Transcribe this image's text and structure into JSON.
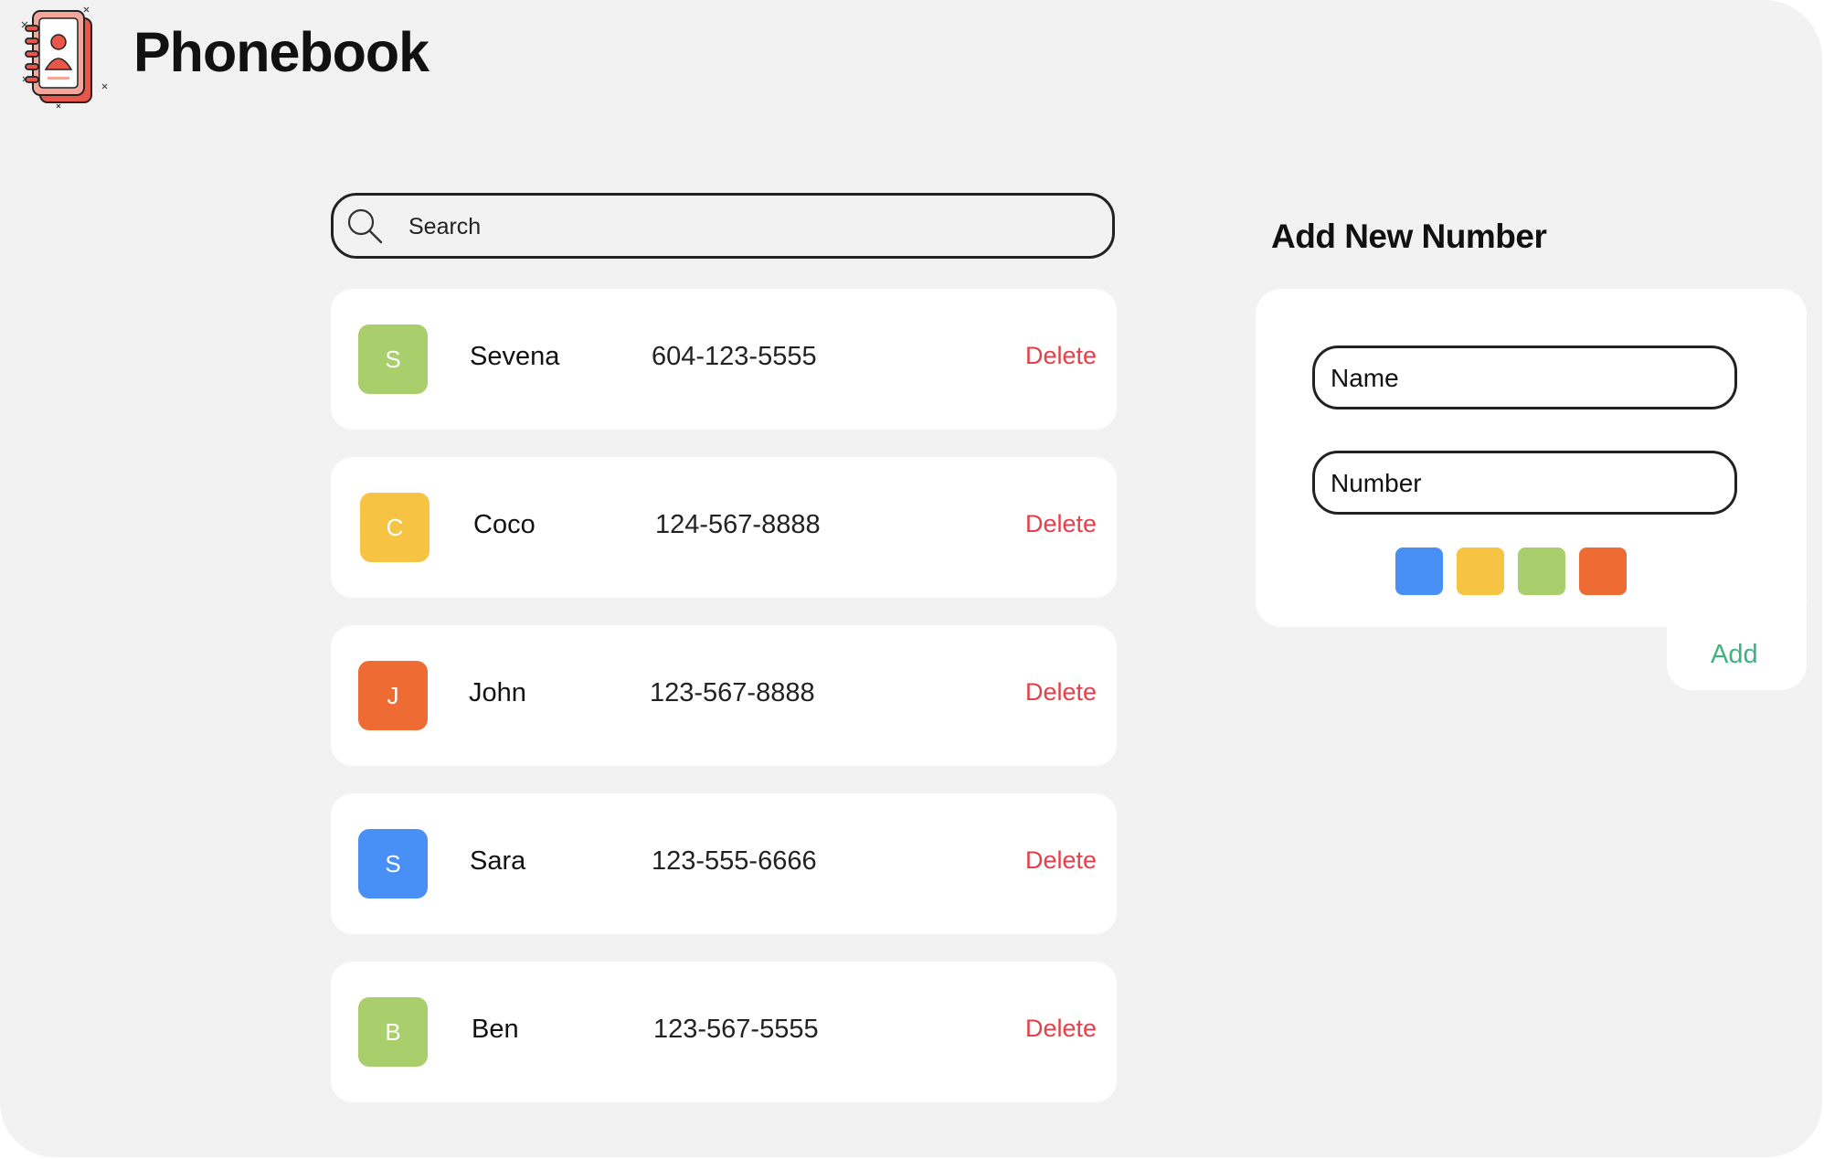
{
  "app": {
    "title": "Phonebook"
  },
  "search": {
    "placeholder": "Search"
  },
  "contacts": [
    {
      "initial": "S",
      "name": "Sevena",
      "number": "604-123-5555",
      "color": "#a8cf6b",
      "delete_label": "Delete"
    },
    {
      "initial": "C",
      "name": "Coco",
      "number": "124-567-8888",
      "color": "#f7c342",
      "delete_label": "Delete"
    },
    {
      "initial": "J",
      "name": "John",
      "number": "123-567-8888",
      "color": "#ee6b33",
      "delete_label": "Delete"
    },
    {
      "initial": "S",
      "name": "Sara",
      "number": "123-555-6666",
      "color": "#4990f6",
      "delete_label": "Delete"
    },
    {
      "initial": "B",
      "name": "Ben",
      "number": "123-567-5555",
      "color": "#a8cf6b",
      "delete_label": "Delete"
    }
  ],
  "add_form": {
    "title": "Add New Number",
    "name_placeholder": "Name",
    "number_placeholder": "Number",
    "colors": [
      "#4990f6",
      "#f7c342",
      "#a8cf6b",
      "#ee6b33"
    ],
    "add_label": "Add"
  },
  "theme": {
    "delete_color": "#e2414b",
    "add_color": "#3fb27f",
    "background": "#f2f2f2"
  }
}
